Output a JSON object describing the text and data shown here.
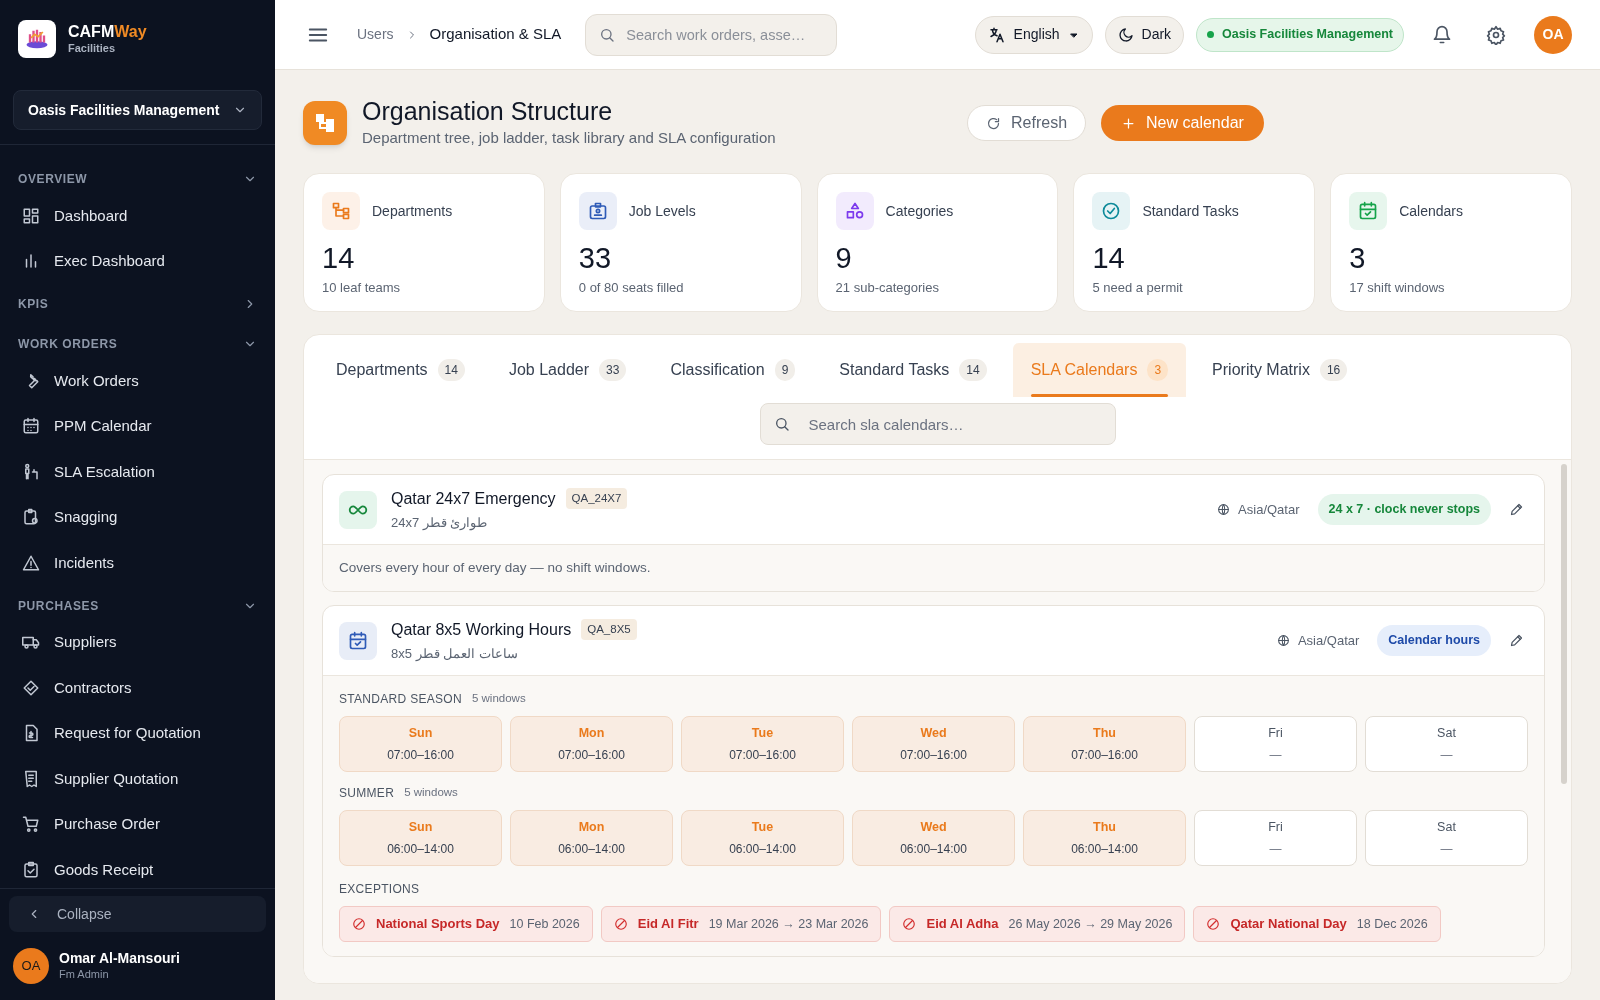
{
  "brand": {
    "name_main": "CAFM",
    "name_accent": "Way",
    "subtitle": "Facilities"
  },
  "org_select": {
    "value": "Oasis Facilities Management"
  },
  "sidebar": {
    "sections": [
      {
        "title": "OVERVIEW",
        "expanded": true,
        "items": [
          {
            "label": "Dashboard"
          },
          {
            "label": "Exec Dashboard"
          }
        ]
      },
      {
        "title": "KPIS",
        "expanded": false
      },
      {
        "title": "WORK ORDERS",
        "expanded": true,
        "items": [
          {
            "label": "Work Orders"
          },
          {
            "label": "PPM Calendar"
          },
          {
            "label": "SLA Escalation"
          },
          {
            "label": "Snagging"
          },
          {
            "label": "Incidents"
          }
        ]
      },
      {
        "title": "PURCHASES",
        "expanded": true,
        "items": [
          {
            "label": "Suppliers"
          },
          {
            "label": "Contractors"
          },
          {
            "label": "Request for Quotation"
          },
          {
            "label": "Supplier Quotation"
          },
          {
            "label": "Purchase Order"
          },
          {
            "label": "Goods Receipt"
          }
        ]
      }
    ],
    "collapse": "Collapse",
    "user": {
      "initials": "OA",
      "name": "Omar Al-Mansouri",
      "role": "Fm Admin"
    }
  },
  "topbar": {
    "breadcrumb": [
      "Users",
      "Organisation & SLA"
    ],
    "search_placeholder": "Search work orders, asse…",
    "language": "English",
    "theme": "Dark",
    "tenant": "Oasis Facilities Management",
    "avatar": "OA"
  },
  "page": {
    "title": "Organisation Structure",
    "subtitle": "Department tree, job ladder, task library and SLA configuration",
    "buttons": [
      "Refresh",
      "New calendar"
    ]
  },
  "stats": [
    {
      "label": "Departments",
      "value": "14",
      "note": "10 leaf teams",
      "color": "#ea7a1c"
    },
    {
      "label": "Job Levels",
      "value": "33",
      "note": "0 of 80 seats filled",
      "color": "#2f5bb7"
    },
    {
      "label": "Categories",
      "value": "9",
      "note": "21 sub-categories",
      "color": "#7c3aed"
    },
    {
      "label": "Standard Tasks",
      "value": "14",
      "note": "5 need a permit",
      "color": "#0e8a9a"
    },
    {
      "label": "Calendars",
      "value": "3",
      "note": "17 shift windows",
      "color": "#16a34a"
    }
  ],
  "tabs": [
    {
      "label": "Departments",
      "count": "14",
      "selected": false
    },
    {
      "label": "Job Ladder",
      "count": "33",
      "selected": false
    },
    {
      "label": "Classification",
      "count": "9",
      "selected": false
    },
    {
      "label": "Standard Tasks",
      "count": "14",
      "selected": false
    },
    {
      "label": "SLA Calendars",
      "count": "3",
      "selected": true
    },
    {
      "label": "Priority Matrix",
      "count": "16",
      "selected": false
    }
  ],
  "list_search": {
    "placeholder": "Search sla calendars…"
  },
  "calendars": [
    {
      "kind": "always",
      "name": "Qatar 24x7 Emergency",
      "code": "QA_24X7",
      "arabic": "طوارئ قطر 24x7",
      "timezone": "Asia/Qatar",
      "badge": "24 x 7 · clock never stops",
      "description": "Covers every hour of every day — no shift windows."
    },
    {
      "kind": "hours",
      "name": "Qatar 8x5 Working Hours",
      "code": "QA_8X5",
      "arabic": "ساعات العمل قطر 8x5",
      "timezone": "Asia/Qatar",
      "badge": "Calendar hours",
      "seasons": [
        {
          "name": "STANDARD SEASON",
          "count": "5 windows",
          "days": [
            {
              "day": "Sun",
              "hours": "07:00–16:00",
              "active": true
            },
            {
              "day": "Mon",
              "hours": "07:00–16:00",
              "active": true
            },
            {
              "day": "Tue",
              "hours": "07:00–16:00",
              "active": true
            },
            {
              "day": "Wed",
              "hours": "07:00–16:00",
              "active": true
            },
            {
              "day": "Thu",
              "hours": "07:00–16:00",
              "active": true
            },
            {
              "day": "Fri",
              "hours": "—",
              "active": false
            },
            {
              "day": "Sat",
              "hours": "—",
              "active": false
            }
          ]
        },
        {
          "name": "SUMMER",
          "count": "5 windows",
          "days": [
            {
              "day": "Sun",
              "hours": "06:00–14:00",
              "active": true
            },
            {
              "day": "Mon",
              "hours": "06:00–14:00",
              "active": true
            },
            {
              "day": "Tue",
              "hours": "06:00–14:00",
              "active": true
            },
            {
              "day": "Wed",
              "hours": "06:00–14:00",
              "active": true
            },
            {
              "day": "Thu",
              "hours": "06:00–14:00",
              "active": true
            },
            {
              "day": "Fri",
              "hours": "—",
              "active": false
            },
            {
              "day": "Sat",
              "hours": "—",
              "active": false
            }
          ]
        }
      ],
      "exceptions_title": "EXCEPTIONS",
      "exceptions": [
        {
          "name": "National Sports Day",
          "dates": "10 Feb 2026"
        },
        {
          "name": "Eid Al Fitr",
          "dates": "19 Mar 2026 → 23 Mar 2026"
        },
        {
          "name": "Eid Al Adha",
          "dates": "26 May 2026 → 29 May 2026"
        },
        {
          "name": "Qatar National Day",
          "dates": "18 Dec 2026"
        }
      ]
    }
  ]
}
